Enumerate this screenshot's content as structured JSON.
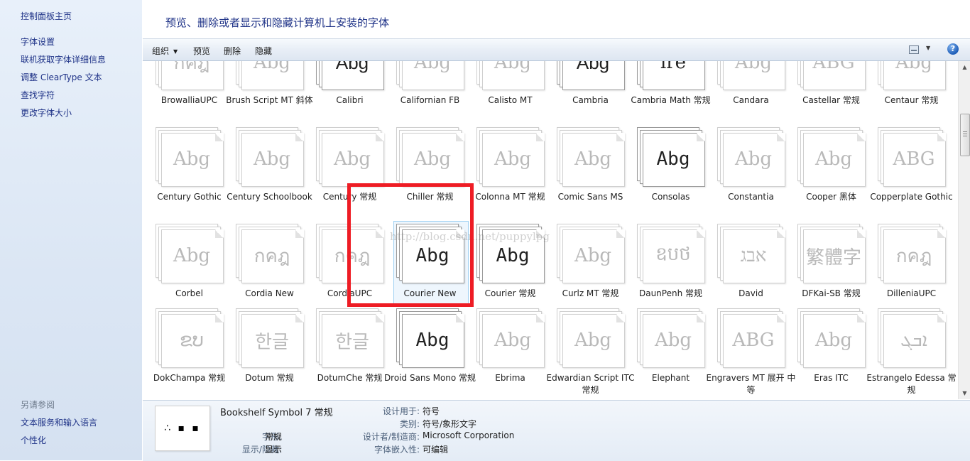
{
  "left_nav": {
    "home": "控制面板主页",
    "links": [
      "字体设置",
      "联机获取字体详细信息",
      "调整 ClearType 文本",
      "查找字符",
      "更改字体大小"
    ],
    "see_also_heading": "另请参阅",
    "see_also": [
      "文本服务和输入语言",
      "个性化"
    ]
  },
  "header": {
    "title": "预览、删除或者显示和隐藏计算机上安装的字体"
  },
  "toolbar": {
    "organize": "组织",
    "preview": "预览",
    "delete": "删除",
    "hide": "隐藏",
    "help": "?"
  },
  "fonts": [
    [
      {
        "name": "BrowalliaUPC",
        "sample": "กคฎ",
        "dark": false
      },
      {
        "name": "Brush Script MT 斜体",
        "sample": "Abg",
        "dark": false
      },
      {
        "name": "Calibri",
        "sample": "Abg",
        "dark": true
      },
      {
        "name": "Californian FB",
        "sample": "Abg",
        "dark": false
      },
      {
        "name": "Calisto MT",
        "sample": "Abg",
        "dark": false
      },
      {
        "name": "Cambria",
        "sample": "Abg",
        "dark": true
      },
      {
        "name": "Cambria Math 常规",
        "sample": "ïre",
        "dark": true
      },
      {
        "name": "Candara",
        "sample": "Abg",
        "dark": false
      },
      {
        "name": "Castellar 常规",
        "sample": "ABG",
        "dark": false
      },
      {
        "name": "Centaur 常规",
        "sample": "Abg",
        "dark": false
      }
    ],
    [
      {
        "name": "Century Gothic",
        "sample": "Abg",
        "dark": false
      },
      {
        "name": "Century Schoolbook",
        "sample": "Abg",
        "dark": false
      },
      {
        "name": "Century 常规",
        "sample": "Abg",
        "dark": false
      },
      {
        "name": "Chiller 常规",
        "sample": "Abg",
        "dark": false
      },
      {
        "name": "Colonna MT 常规",
        "sample": "Abg",
        "dark": false
      },
      {
        "name": "Comic Sans MS",
        "sample": "Abg",
        "dark": false
      },
      {
        "name": "Consolas",
        "sample": "Abg",
        "dark": true
      },
      {
        "name": "Constantia",
        "sample": "Abg",
        "dark": false
      },
      {
        "name": "Cooper 黑体",
        "sample": "Abg",
        "dark": false
      },
      {
        "name": "Copperplate Gothic",
        "sample": "ABG",
        "dark": false
      }
    ],
    [
      {
        "name": "Corbel",
        "sample": "Abg",
        "dark": false
      },
      {
        "name": "Cordia New",
        "sample": "กคฎ",
        "dark": false
      },
      {
        "name": "CordiaUPC",
        "sample": "กคฎ",
        "dark": false
      },
      {
        "name": "Courier New",
        "sample": "Abg",
        "dark": true
      },
      {
        "name": "Courier 常规",
        "sample": "Abg",
        "dark": true
      },
      {
        "name": "Curlz MT 常规",
        "sample": "Abg",
        "dark": false
      },
      {
        "name": "DaunPenh 常规",
        "sample": "ឧបថ",
        "dark": false
      },
      {
        "name": "David",
        "sample": "אבג",
        "dark": false
      },
      {
        "name": "DFKai-SB 常规",
        "sample": "繁體字",
        "dark": false
      },
      {
        "name": "DilleniaUPC",
        "sample": "กคฎ",
        "dark": false
      }
    ],
    [
      {
        "name": "DokChampa 常规",
        "sample": "ຂບ",
        "dark": false
      },
      {
        "name": "Dotum 常规",
        "sample": "한글",
        "dark": false
      },
      {
        "name": "DotumChe 常规",
        "sample": "한글",
        "dark": false
      },
      {
        "name": "Droid Sans Mono 常规",
        "sample": "Abg",
        "dark": true
      },
      {
        "name": "Ebrima",
        "sample": "Abg",
        "dark": false
      },
      {
        "name": "Edwardian Script ITC 常规",
        "sample": "Abg",
        "dark": false
      },
      {
        "name": "Elephant",
        "sample": "Abg",
        "dark": false
      },
      {
        "name": "Engravers MT 展开 中等",
        "sample": "ABG",
        "dark": false
      },
      {
        "name": "Eras ITC",
        "sample": "Abg",
        "dark": false
      },
      {
        "name": "Estrangelo Edessa 常规",
        "sample": "ܐܒܓ",
        "dark": false
      }
    ]
  ],
  "details": {
    "font_name": "Bookshelf Symbol 7 常规",
    "glyphs": "∴ ▪ ▪",
    "style_label": "字形:",
    "style_value": "常规",
    "visibility_label": "显示/隐藏:",
    "visibility_value": "显示",
    "designed_for_label": "设计用于:",
    "designed_for_value": "符号",
    "category_label": "类别:",
    "category_value": "符号/象形文字",
    "designer_label": "设计者/制造商:",
    "designer_value": "Microsoft Corporation",
    "embed_label": "字体嵌入性:",
    "embed_value": "可编辑"
  },
  "watermark": "http://blog.csdn.net/puppylpg",
  "colors": {
    "highlight": "#ee1c24",
    "link": "#1e3287",
    "selection_border": "#9fd0f2"
  }
}
